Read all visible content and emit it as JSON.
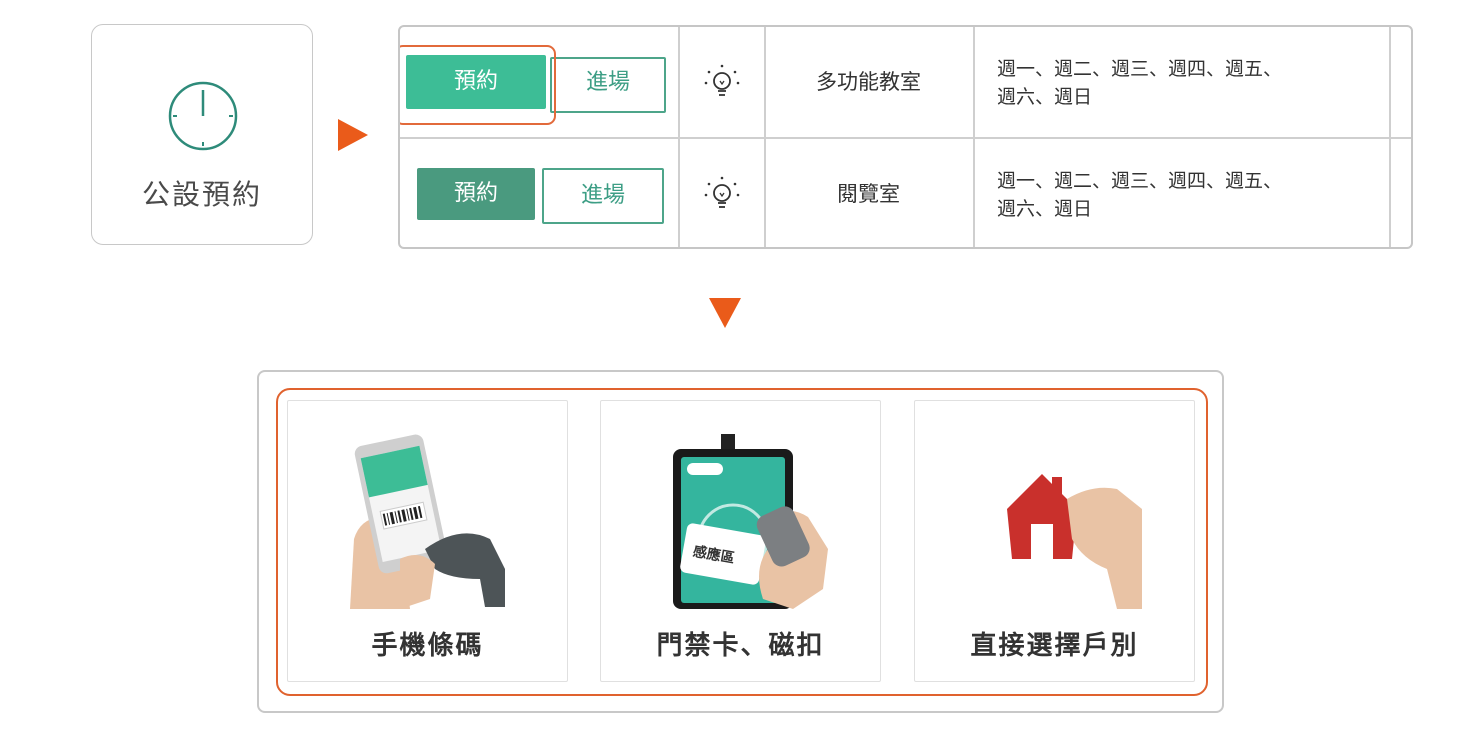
{
  "facility": {
    "label": "公設預約"
  },
  "table": {
    "rows": [
      {
        "reserve_label": "預約",
        "enter_label": "進場",
        "room": "多功能教室",
        "days_line1": "週一、週二、週三、週四、週五、",
        "days_line2": "週六、週日"
      },
      {
        "reserve_label": "預約",
        "enter_label": "進場",
        "room": "閱覽室",
        "days_line1": "週一、週二、週三、週四、週五、",
        "days_line2": "週六、週日"
      }
    ]
  },
  "methods": [
    {
      "label": "手機條碼"
    },
    {
      "label": "門禁卡、磁扣"
    },
    {
      "label": "直接選擇戶別"
    }
  ],
  "colors": {
    "accent": "#ea5b1a",
    "green": "#3dbd96",
    "green_dark": "#4a9a7f"
  }
}
